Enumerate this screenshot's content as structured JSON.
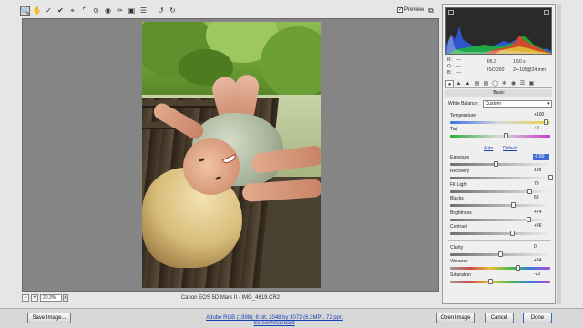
{
  "toolbar": {
    "tools": [
      "zoom-icon",
      "hand-icon",
      "white-balance-icon",
      "color-sampler-icon",
      "crop-icon",
      "straighten-icon",
      "retouch-icon",
      "red-eye-icon",
      "adjustment-brush-icon",
      "graduated-filter-icon",
      "preferences-icon",
      "rotate-left-icon",
      "rotate-right-icon"
    ],
    "preview_label": "Preview",
    "preview_checked": true
  },
  "canvas": {
    "zoom_value": "20.3%",
    "caption": "Canon EOS 5D Mark II  -  IMG_4619.CR2"
  },
  "camera_info": {
    "r_label": "R:",
    "g_label": "G:",
    "b_label": "B:",
    "r_value": "---",
    "g_value": "---",
    "b_value": "---",
    "aperture": "f/6.3",
    "shutter": "1/50 s",
    "iso": "ISO 200",
    "lens": "24-105@24 mm"
  },
  "panel": {
    "section_title": "Basic",
    "white_balance_label": "White Balance:",
    "white_balance_value": "Custom",
    "auto_label": "Auto",
    "default_label": "Default",
    "sliders": [
      {
        "key": "temperature",
        "label": "Temperature",
        "value": "+100",
        "position": 0.95,
        "selected": false
      },
      {
        "key": "tint",
        "label": "Tint",
        "value": "+9",
        "position": 0.55,
        "selected": false
      },
      {
        "key": "exposure",
        "label": "Exposure",
        "value": "-0.50",
        "position": 0.45,
        "selected": true
      },
      {
        "key": "recovery",
        "label": "Recovery",
        "value": "100",
        "position": 1.0,
        "selected": false
      },
      {
        "key": "fill_light",
        "label": "Fill Light",
        "value": "79",
        "position": 0.79,
        "selected": false
      },
      {
        "key": "blacks",
        "label": "Blacks",
        "value": "63",
        "position": 0.63,
        "selected": false
      },
      {
        "key": "brightness",
        "label": "Brightness",
        "value": "+74",
        "position": 0.78,
        "selected": false
      },
      {
        "key": "contrast",
        "label": "Contrast",
        "value": "+36",
        "position": 0.62,
        "selected": false
      },
      {
        "key": "clarity",
        "label": "Clarity",
        "value": "0",
        "position": 0.5,
        "selected": false
      },
      {
        "key": "vibrance",
        "label": "Vibrance",
        "value": "+34",
        "position": 0.67,
        "selected": false
      },
      {
        "key": "saturation",
        "label": "Saturation",
        "value": "-22",
        "position": 0.4,
        "selected": false
      }
    ]
  },
  "footer": {
    "save_label": "Save Image...",
    "workflow_link": "Adobe RGB (1998); 8 bit; 2048 by 3072 (6.3MP); 72 ppi; Screen/Standard",
    "open_label": "Open Image",
    "cancel_label": "Cancel",
    "done_label": "Done"
  },
  "colors": {
    "link": "#1a3fb5",
    "selection": "#3c6bd4",
    "canvas_bg": "#858585"
  }
}
